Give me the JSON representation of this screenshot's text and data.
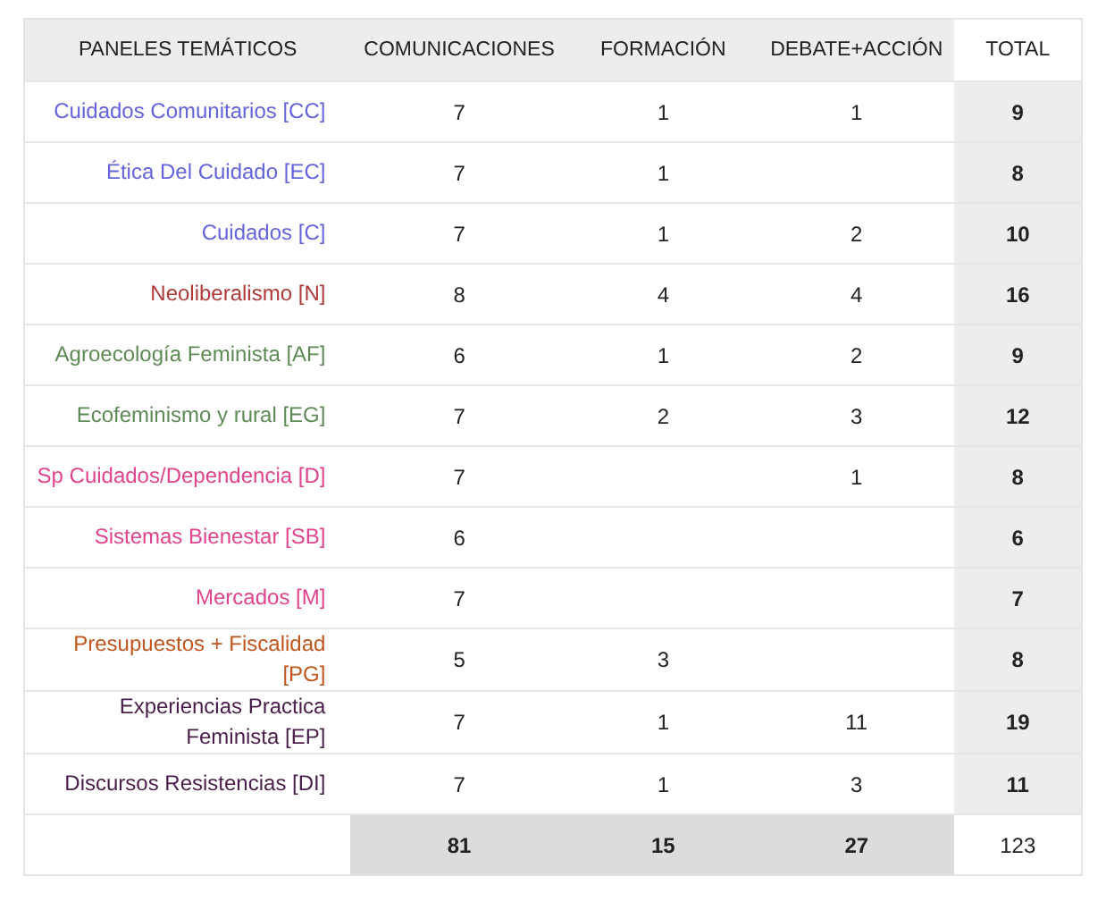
{
  "table": {
    "columns": [
      "PANELES TEMÁTICOS",
      "COMUNICACIONES",
      "FORMACIÓN",
      "DEBATE+ACCIÓN",
      "TOTAL"
    ],
    "rows": [
      {
        "panel": "Cuidados Comunitarios [CC]",
        "color": "#6464dc",
        "comunicaciones": "7",
        "formacion": "1",
        "debate_accion": "1",
        "total": "9"
      },
      {
        "panel": "Ética Del Cuidado [EC]",
        "color": "#6464dc",
        "comunicaciones": "7",
        "formacion": "1",
        "total": "8"
      },
      {
        "panel": "Cuidados [C]",
        "color": "#6464dc",
        "comunicaciones": "7",
        "formacion": "1",
        "debate_accion": "2",
        "total": "10"
      },
      {
        "panel": "Neoliberalismo [N]",
        "color": "#b03a3a",
        "comunicaciones": "8",
        "formacion": "4",
        "debate_accion": "4",
        "total": "16"
      },
      {
        "panel": "Agroecología Feminista [AF]",
        "color": "#5e8a56",
        "comunicaciones": "6",
        "formacion": "1",
        "debate_accion": "2",
        "total": "9"
      },
      {
        "panel": "Ecofeminismo y rural [EG]",
        "color": "#5e8a56",
        "comunicaciones": "7",
        "formacion": "2",
        "debate_accion": "3",
        "total": "12"
      },
      {
        "panel": "Sp Cuidados/Dependencia [D]",
        "color": "#e0448c",
        "comunicaciones": "7",
        "debate_accion": "1",
        "total": "8"
      },
      {
        "panel": "Sistemas Bienestar [SB]",
        "color": "#e0448c",
        "comunicaciones": "6",
        "total": "6"
      },
      {
        "panel": "Mercados [M]",
        "color": "#e0448c",
        "comunicaciones": "7",
        "total": "7"
      },
      {
        "panel": "Presupuestos + Fiscalidad [PG]",
        "color": "#c0561e",
        "comunicaciones": "5",
        "formacion": "3",
        "total": "8"
      },
      {
        "panel": "Experiencias Practica Feminista [EP]",
        "color": "#4a1e4a",
        "comunicaciones": "7",
        "formacion": "1",
        "debate_accion": "11",
        "total": "19"
      },
      {
        "panel": "Discursos Resistencias [DI]",
        "color": "#4a1e4a",
        "comunicaciones": "7",
        "formacion": "1",
        "debate_accion": "3",
        "total": "11"
      }
    ],
    "totals": {
      "comunicaciones": "81",
      "formacion": "15",
      "debate_accion": "27",
      "total": "123"
    }
  }
}
